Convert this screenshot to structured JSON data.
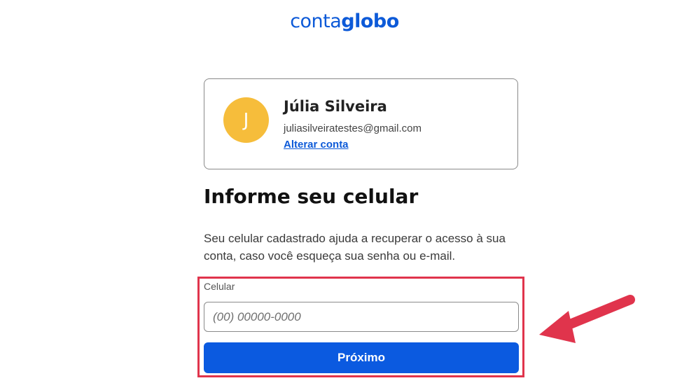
{
  "logo": {
    "part1": "conta",
    "part2": "globo"
  },
  "account": {
    "avatar_initial": "J",
    "name": "Júlia Silveira",
    "email": "juliasilveiratestes@gmail.com",
    "switch_label": "Alterar conta"
  },
  "form": {
    "heading": "Informe seu celular",
    "description": "Seu celular cadastrado ajuda a recuperar o acesso à sua conta, caso você esqueça sua senha ou e-mail.",
    "phone_label": "Celular",
    "phone_placeholder": "(00) 00000-0000",
    "phone_value": "",
    "next_label": "Próximo"
  },
  "colors": {
    "brand_blue": "#0b5ae0",
    "avatar_yellow": "#f6bd3b",
    "highlight_red": "#e0344c"
  },
  "icons": {
    "annotation": "red-arrow-icon"
  }
}
